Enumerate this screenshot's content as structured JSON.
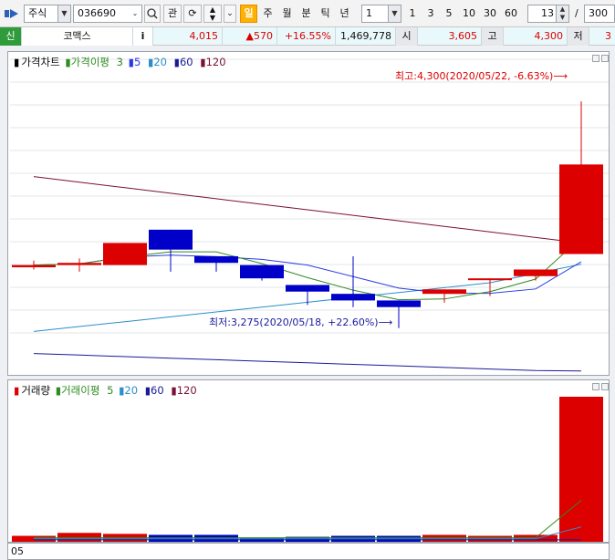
{
  "toolbar": {
    "market_type": "주식",
    "code": "036690",
    "btn_gwan": "관",
    "period_buttons": [
      "일",
      "주",
      "월",
      "분",
      "틱",
      "년"
    ],
    "active_period": "일",
    "interval_select": "1",
    "interval_buttons": [
      "1",
      "3",
      "5",
      "10",
      "30",
      "60"
    ],
    "count_value": "13",
    "slash": "/",
    "total_value": "300"
  },
  "quote": {
    "market_badge": "신",
    "name": "코맥스",
    "info_btn": "i",
    "price": "4,015",
    "change": "▲570",
    "change_pct": "+16.55%",
    "volume": "1,469,778",
    "open_label": "시",
    "open": "3,605",
    "high_label": "고",
    "high": "4,300",
    "low_label": "저",
    "low": "3"
  },
  "price_panel": {
    "legend": {
      "title": "가격차트",
      "ma_label": "가격이평",
      "periods": [
        "3",
        "5",
        "20",
        "60",
        "120"
      ]
    },
    "annotation_high": "최고:4,300(2020/05/22, -6.63%)⟶",
    "annotation_low": "최저:3,275(2020/05/18, +22.60%)⟶"
  },
  "volume_panel": {
    "legend": {
      "title": "거래량",
      "ma_label": "거래이평",
      "periods": [
        "5",
        "20",
        "60",
        "120"
      ]
    }
  },
  "date_axis": {
    "label": "05"
  },
  "colors": {
    "up": "#dd0000",
    "down": "#0000c8",
    "ma3": "#2e8b22",
    "ma5": "#2a3ce0",
    "ma20": "#2a8fc8",
    "ma60": "#1a1a99",
    "ma120": "#7a1038"
  },
  "chart_data": {
    "type": "candlestick",
    "candles": [
      {
        "o": 3550,
        "h": 3580,
        "l": 3540,
        "c": 3560
      },
      {
        "o": 3560,
        "h": 3590,
        "l": 3530,
        "c": 3570
      },
      {
        "o": 3560,
        "h": 3660,
        "l": 3560,
        "c": 3660
      },
      {
        "o": 3720,
        "h": 3720,
        "l": 3530,
        "c": 3630
      },
      {
        "o": 3600,
        "h": 3600,
        "l": 3530,
        "c": 3570
      },
      {
        "o": 3560,
        "h": 3560,
        "l": 3490,
        "c": 3500
      },
      {
        "o": 3470,
        "h": 3470,
        "l": 3380,
        "c": 3440
      },
      {
        "o": 3430,
        "h": 3600,
        "l": 3370,
        "c": 3400
      },
      {
        "o": 3400,
        "h": 3400,
        "l": 3275,
        "c": 3370
      },
      {
        "o": 3430,
        "h": 3450,
        "l": 3390,
        "c": 3450
      },
      {
        "o": 3500,
        "h": 3500,
        "l": 3420,
        "c": 3500
      },
      {
        "o": 3510,
        "h": 3540,
        "l": 3490,
        "c": 3540
      },
      {
        "o": 3610,
        "h": 4300,
        "l": 3610,
        "c": 4015
      }
    ],
    "volumes": [
      60000,
      90000,
      80000,
      70000,
      70000,
      40000,
      50000,
      60000,
      60000,
      70000,
      60000,
      70000,
      1469778
    ]
  }
}
